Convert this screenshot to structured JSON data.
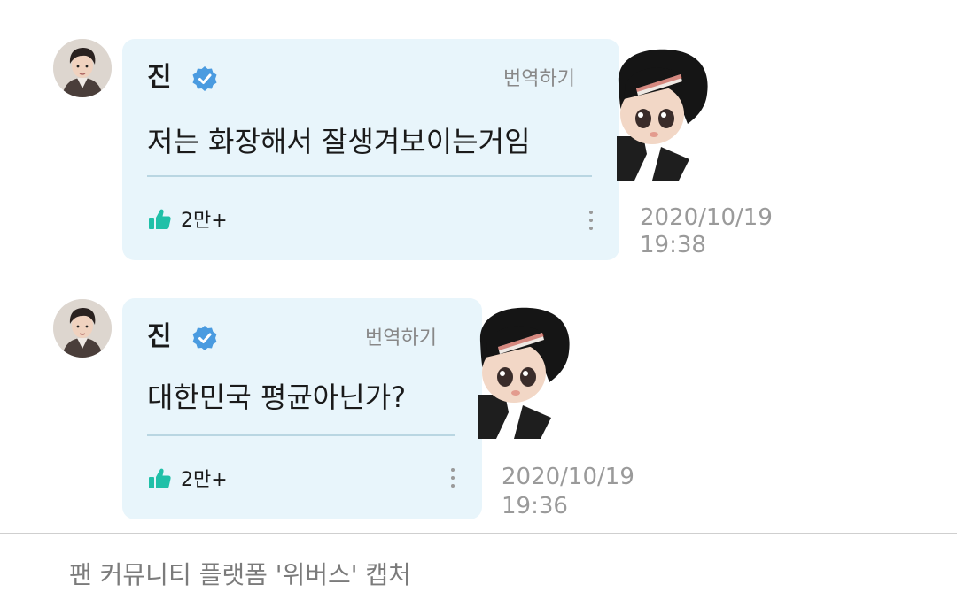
{
  "colors": {
    "bubble_background": "#e8f5fb",
    "verified_badge": "#4a9be0",
    "like_icon": "#20c0a8",
    "timestamp_text": "#9a9a9a",
    "divider": "#b9d6e2"
  },
  "messages": [
    {
      "author": "진",
      "verified_icon": "verified-badge-icon",
      "translate_label": "번역하기",
      "text": "저는 화장해서 잘생겨보이는거임",
      "like_icon": "thumbs-up-icon",
      "likes": "2만+",
      "more_icon": "more-vertical-icon",
      "date": "2020/10/19",
      "time": "19:38"
    },
    {
      "author": "진",
      "verified_icon": "verified-badge-icon",
      "translate_label": "번역하기",
      "text": "대한민국 평균아닌가?",
      "like_icon": "thumbs-up-icon",
      "likes": "2만+",
      "more_icon": "more-vertical-icon",
      "date": "2020/10/19",
      "time": "19:36"
    }
  ],
  "caption": "팬 커뮤니티 플랫폼 '위버스' 캡처"
}
